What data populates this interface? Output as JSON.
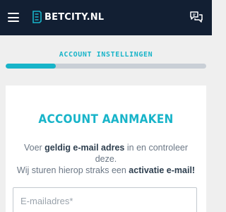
{
  "header": {
    "logo_text": "BETCITY.NL",
    "menu_icon": "hamburger-icon",
    "chat_icon": "chat-bubbles-icon",
    "background_color": "#121f33"
  },
  "step": {
    "label": "ACCOUNT INSTELLINGEN",
    "progress_fraction": 0.25,
    "accent_color": "#18b4c9"
  },
  "card": {
    "title": "ACCOUNT AANMAKEN",
    "body": {
      "part1": "Voer ",
      "bold1": "geldig e-mail adres",
      "part2": " in en controleer deze.",
      "part3": "Wij sturen hierop straks een ",
      "bold2": "activatie e-mail!"
    },
    "email_placeholder": "E-mailadres*"
  }
}
